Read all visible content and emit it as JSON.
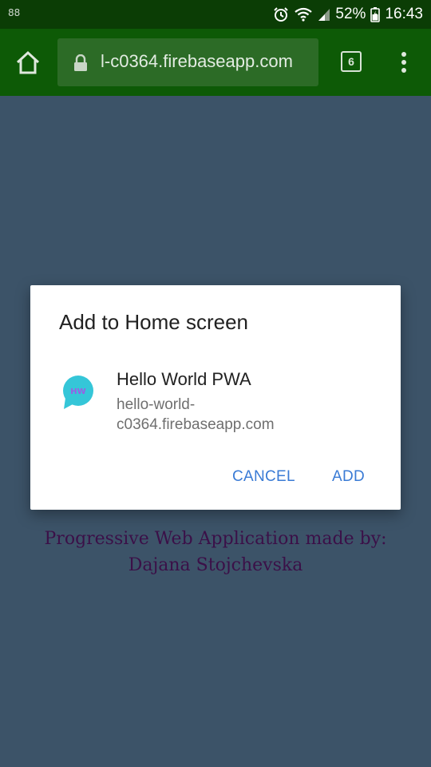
{
  "status_bar": {
    "notification_glyph": "88",
    "battery_percent": "52%",
    "time": "16:43",
    "icons": [
      "alarm-icon",
      "wifi-icon",
      "signal-icon",
      "battery-icon"
    ]
  },
  "toolbar": {
    "url": "l-c0364.firebaseapp.com",
    "tab_count": "6",
    "icons": [
      "home-icon",
      "lock-icon",
      "tab-switcher-icon",
      "overflow-menu-icon"
    ]
  },
  "dialog": {
    "title": "Add to Home screen",
    "app_name": "Hello World PWA",
    "app_url": "hello-world-c0364.firebaseapp.com",
    "app_icon_text": "HW",
    "cancel_label": "CANCEL",
    "add_label": "ADD",
    "accent_color": "#3a7bd5"
  },
  "page": {
    "line1": "Progressive Web Application made by:",
    "line2": "Dajana Stojchevska"
  },
  "colors": {
    "status_bar": "#0b3d05",
    "toolbar": "#0d5a06",
    "page_background": "#3c5368",
    "page_text": "#3b1048"
  }
}
